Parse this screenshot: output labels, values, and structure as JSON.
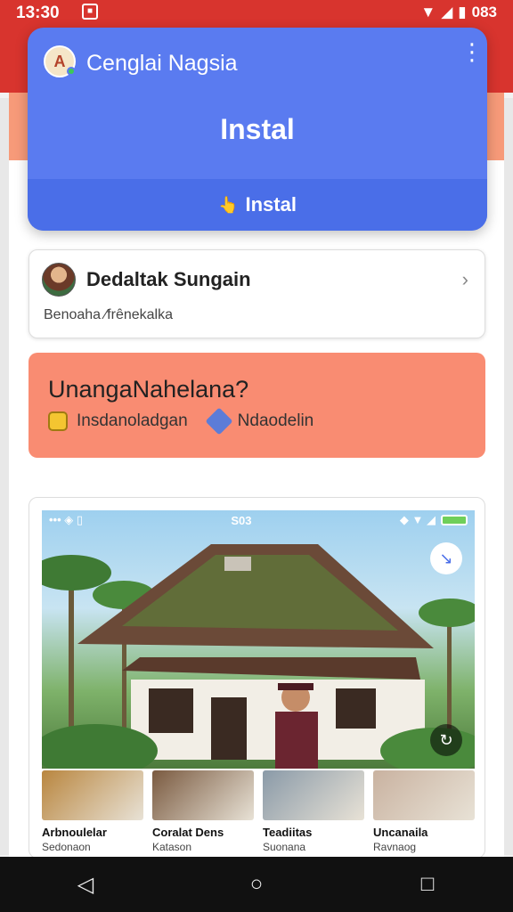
{
  "status_bar": {
    "time": "13:30",
    "right_text": "083"
  },
  "install_card": {
    "app_name": "Cenglai Nagsia",
    "big_label": "Instal",
    "button_label": "Instal"
  },
  "profile_card": {
    "title": "Dedaltak Sungain",
    "subtitle": "Benoaha  ⁄frênekalka"
  },
  "alert_card": {
    "heading": "UnangaNahelana?",
    "item1": "Insdanoladgan",
    "item2": "Ndaodelin"
  },
  "media": {
    "inner_status_center": "S03",
    "thumbnails": [
      {
        "title": "Arbnoulelar",
        "subtitle": "Sedonaon",
        "color": "#b9863f"
      },
      {
        "title": "Coralat Dens",
        "subtitle": "Katason",
        "color": "#7a5a40"
      },
      {
        "title": "Teadiitas",
        "subtitle": "Suonana",
        "color": "#8a9aa8"
      },
      {
        "title": "Uncanaila",
        "subtitle": "Ravnaog",
        "color": "#c9b2a0"
      }
    ]
  },
  "colors": {
    "status_bar": "#d8342e",
    "install_card": "#5a7bf0",
    "alert_card": "#f98c72"
  },
  "icons": {
    "nav_back": "back-triangle",
    "nav_home": "home-circle",
    "nav_recent": "recent-square"
  }
}
